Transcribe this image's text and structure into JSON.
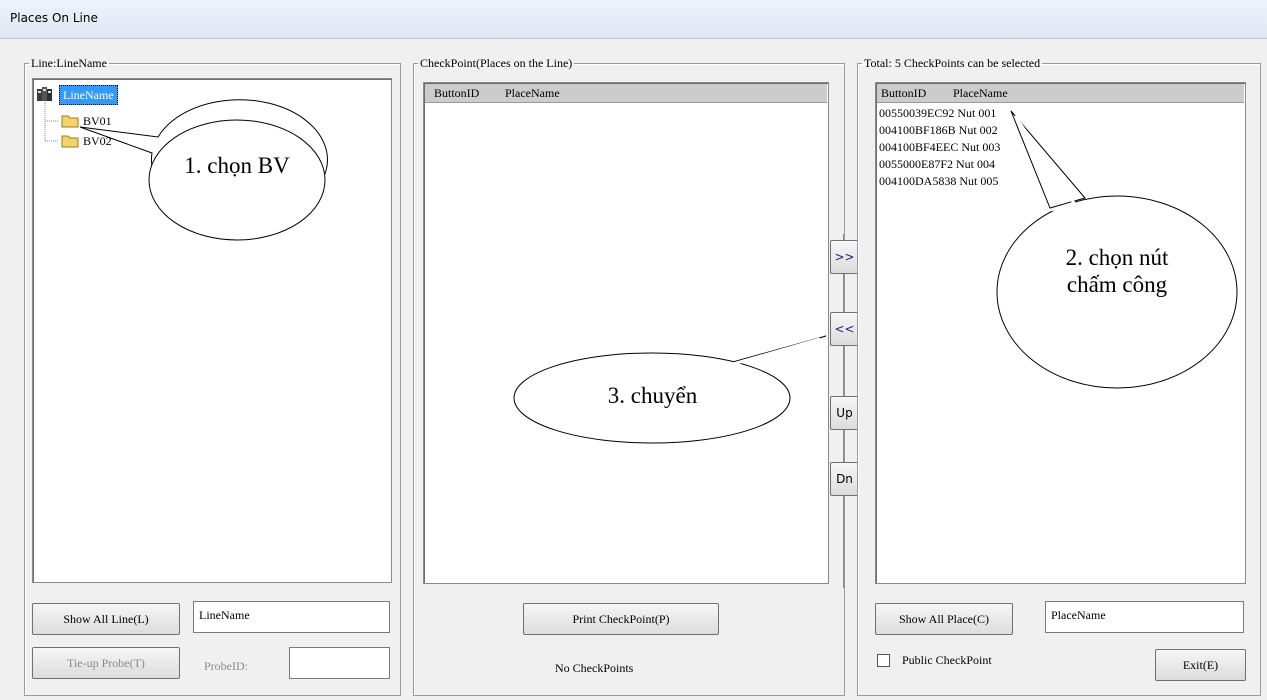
{
  "window": {
    "title": "Places On Line"
  },
  "left_group": {
    "legend": "Line:LineName",
    "tree": {
      "root": "LineName",
      "children": [
        "BV01",
        "BV02"
      ]
    },
    "show_all_button": "Show All Line(L)",
    "line_name_value": "LineName",
    "tieup_button": "Tie-up Probe(T)",
    "probe_label": "ProbeID:",
    "probe_value": ""
  },
  "middle_group": {
    "legend": "CheckPoint(Places on the Line)",
    "columns": [
      "ButtonID",
      "PlaceName"
    ],
    "print_button": "Print CheckPoint(P)",
    "status": "No CheckPoints"
  },
  "transfer_buttons": {
    "add": ">>",
    "remove": "<<",
    "up": "Up",
    "down": "Dn"
  },
  "right_group": {
    "legend": "Total: 5 CheckPoints can be selected",
    "columns": [
      "ButtonID",
      "PlaceName"
    ],
    "rows": [
      "00550039EC92 Nut 001",
      "004100BF186B Nut 002",
      "004100BF4EEC Nut 003",
      "0055000E87F2 Nut 004",
      "004100DA5838 Nut 005"
    ],
    "show_all_button": "Show All Place(C)",
    "place_name_value": "PlaceName",
    "public_checkbox_label": "Public CheckPoint",
    "exit_button": "Exit(E)"
  },
  "callouts": {
    "one": "1. chọn BV",
    "two": "2. chọn nút chấm công",
    "three": "3. chuyển"
  },
  "colors": {
    "selection": "#3399ff",
    "folder": "#f2d46b"
  }
}
